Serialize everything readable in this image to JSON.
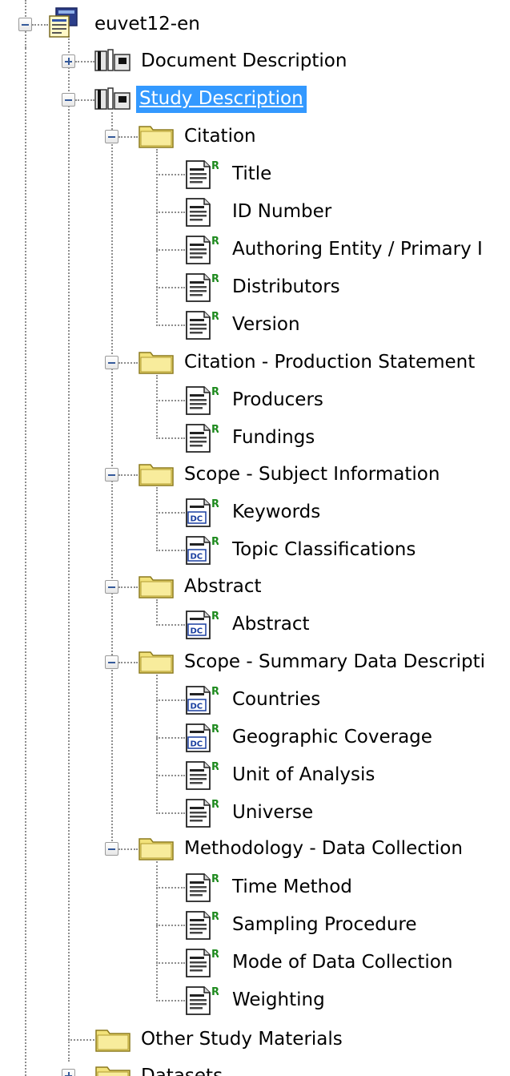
{
  "tree": {
    "root": {
      "label": "euvet12-en"
    },
    "document_description": {
      "label": "Document Description"
    },
    "study_description": {
      "label": "Study Description"
    },
    "citation": {
      "label": "Citation",
      "items": [
        "Title",
        "ID Number",
        "Authoring Entity / Primary I",
        "Distributors",
        "Version"
      ]
    },
    "production_statement": {
      "label": "Citation - Production Statement",
      "items": [
        "Producers",
        "Fundings"
      ]
    },
    "subject_information": {
      "label": "Scope - Subject Information",
      "items": [
        "Keywords",
        "Topic Classifications"
      ]
    },
    "abstract": {
      "label": "Abstract",
      "items": [
        "Abstract"
      ]
    },
    "summary_data": {
      "label": "Scope - Summary Data Descripti",
      "items": [
        "Countries",
        "Geographic Coverage",
        "Unit of Analysis",
        "Universe"
      ]
    },
    "data_collection": {
      "label": "Methodology - Data Collection",
      "items": [
        "Time Method",
        "Sampling Procedure",
        "Mode of Data Collection",
        "Weighting"
      ]
    },
    "other_study_materials": {
      "label": "Other Study Materials"
    },
    "datasets": {
      "label": "Datasets"
    }
  },
  "icons": {
    "recommended_marker": "R",
    "dublin_core_marker": "DC"
  },
  "colors": {
    "selection": "#3399ff",
    "folder": "#f2e27a",
    "recommended": "#1e8a1e"
  }
}
